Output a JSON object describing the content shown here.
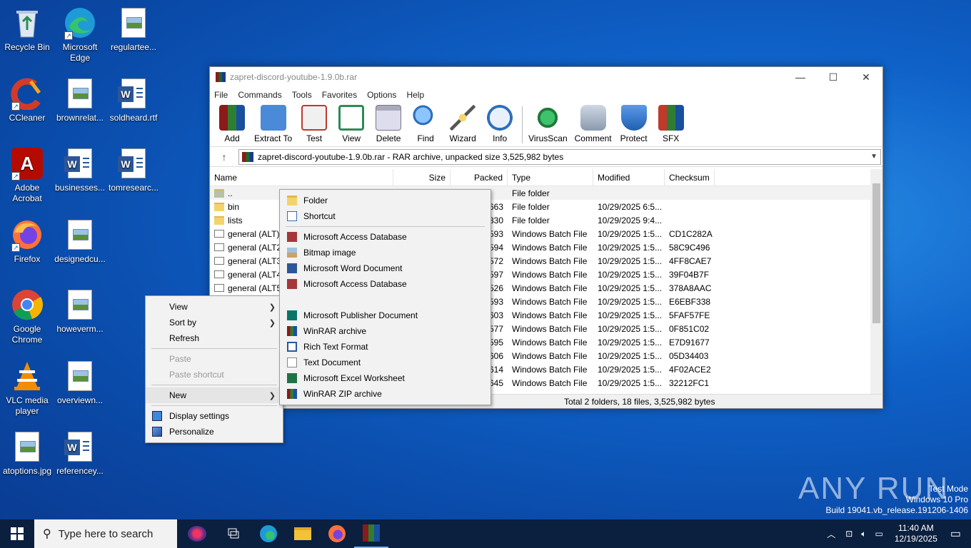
{
  "desktop": {
    "icons": [
      {
        "label": "Recycle Bin"
      },
      {
        "label": "Microsoft Edge"
      },
      {
        "label": "regulartee..."
      },
      {
        "label": "CCleaner"
      },
      {
        "label": "brownrelat..."
      },
      {
        "label": "soldheard.rtf"
      },
      {
        "label": "Adobe Acrobat"
      },
      {
        "label": "businesses..."
      },
      {
        "label": "tomresearc..."
      },
      {
        "label": "Firefox"
      },
      {
        "label": "designedcu..."
      },
      {
        "label": "Google Chrome"
      },
      {
        "label": "howeverm..."
      },
      {
        "label": "VLC media player"
      },
      {
        "label": "overviewn..."
      },
      {
        "label": "atoptions.jpg"
      },
      {
        "label": "referencey..."
      }
    ]
  },
  "window": {
    "title": "zapret-discord-youtube-1.9.0b.rar",
    "controls": {
      "minimize": "—",
      "maximize": "☐",
      "close": "✕"
    },
    "menu": [
      "File",
      "Commands",
      "Tools",
      "Favorites",
      "Options",
      "Help"
    ],
    "toolbar": [
      {
        "label": "Add",
        "icon": "add-icon",
        "color": "#c0392b"
      },
      {
        "label": "Extract To",
        "icon": "extract-icon",
        "color": "#3a7bd5"
      },
      {
        "label": "Test",
        "icon": "test-icon",
        "color": "#d9534f"
      },
      {
        "label": "View",
        "icon": "view-icon",
        "color": "#2e8b57"
      },
      {
        "label": "Delete",
        "icon": "delete-icon",
        "color": "#7f8c8d"
      },
      {
        "label": "Find",
        "icon": "find-icon",
        "color": "#2c6fbb"
      },
      {
        "label": "Wizard",
        "icon": "wizard-icon",
        "color": "#9b59b6"
      },
      {
        "label": "Info",
        "icon": "info-icon",
        "color": "#2c6fbb"
      },
      {
        "label": "VirusScan",
        "icon": "virusscan-icon",
        "color": "#27ae60"
      },
      {
        "label": "Comment",
        "icon": "comment-icon",
        "color": "#5d6d7e"
      },
      {
        "label": "Protect",
        "icon": "protect-icon",
        "color": "#2c6fbb"
      },
      {
        "label": "SFX",
        "icon": "sfx-icon",
        "color": "#c0392b"
      }
    ],
    "address": "zapret-discord-youtube-1.9.0b.rar - RAR archive, unpacked size 3,525,982 bytes",
    "columns": {
      "name": "Name",
      "size": "Size",
      "packed": "Packed",
      "type": "Type",
      "modified": "Modified",
      "checksum": "Checksum"
    },
    "rows": [
      {
        "name": "..",
        "packed": "",
        "type": "File folder",
        "modified": "",
        "checksum": "",
        "kind": "up"
      },
      {
        "name": "bin",
        "packed": "663",
        "type": "File folder",
        "modified": "10/29/2025 6:5...",
        "checksum": "",
        "kind": "folder"
      },
      {
        "name": "lists",
        "packed": "830",
        "type": "File folder",
        "modified": "10/29/2025 9:4...",
        "checksum": "",
        "kind": "folder"
      },
      {
        "name": "general (ALT).b",
        "packed": "593",
        "type": "Windows Batch File",
        "modified": "10/29/2025 1:5...",
        "checksum": "CD1C282A",
        "kind": "bat"
      },
      {
        "name": "general (ALT2).",
        "packed": "594",
        "type": "Windows Batch File",
        "modified": "10/29/2025 1:5...",
        "checksum": "58C9C496",
        "kind": "bat"
      },
      {
        "name": "general (ALT3).",
        "packed": "572",
        "type": "Windows Batch File",
        "modified": "10/29/2025 1:5...",
        "checksum": "4FF8CAE7",
        "kind": "bat"
      },
      {
        "name": "general (ALT4).",
        "packed": "597",
        "type": "Windows Batch File",
        "modified": "10/29/2025 1:5...",
        "checksum": "39F04B7F",
        "kind": "bat"
      },
      {
        "name": "general (ALT5).",
        "packed": "526",
        "type": "Windows Batch File",
        "modified": "10/29/2025 1:5...",
        "checksum": "378A8AAC",
        "kind": "bat"
      },
      {
        "name": "",
        "packed": "593",
        "type": "Windows Batch File",
        "modified": "10/29/2025 1:5...",
        "checksum": "E6EBF338",
        "kind": "bat"
      },
      {
        "name": "",
        "packed": "603",
        "type": "Windows Batch File",
        "modified": "10/29/2025 1:5...",
        "checksum": "5FAF57FE",
        "kind": "bat"
      },
      {
        "name": "",
        "packed": "577",
        "type": "Windows Batch File",
        "modified": "10/29/2025 1:5...",
        "checksum": "0F851C02",
        "kind": "bat"
      },
      {
        "name": "",
        "packed": "595",
        "type": "Windows Batch File",
        "modified": "10/29/2025 1:5...",
        "checksum": "E7D91677",
        "kind": "bat"
      },
      {
        "name": "",
        "packed": "606",
        "type": "Windows Batch File",
        "modified": "10/29/2025 1:5...",
        "checksum": "05D34403",
        "kind": "bat"
      },
      {
        "name": "",
        "packed": "614",
        "type": "Windows Batch File",
        "modified": "10/29/2025 1:5...",
        "checksum": "4F02ACE2",
        "kind": "bat"
      },
      {
        "name": "",
        "packed": "645",
        "type": "Windows Batch File",
        "modified": "10/29/2025 1:5...",
        "checksum": "32212FC1",
        "kind": "bat"
      }
    ],
    "status": "Total 2 folders, 18 files, 3,525,982 bytes"
  },
  "context_menu": {
    "view": "View",
    "sort_by": "Sort by",
    "refresh": "Refresh",
    "paste": "Paste",
    "paste_shortcut": "Paste shortcut",
    "new": "New",
    "display_settings": "Display settings",
    "personalize": "Personalize"
  },
  "new_menu": [
    {
      "label": "Folder",
      "icon": "folder-icon"
    },
    {
      "label": "Shortcut",
      "icon": "shortcut-icon"
    },
    {
      "label": "Microsoft Access Database",
      "icon": "access-icon"
    },
    {
      "label": "Bitmap image",
      "icon": "bitmap-icon"
    },
    {
      "label": "Microsoft Word Document",
      "icon": "word-icon"
    },
    {
      "label": "Microsoft Access Database",
      "icon": "access-icon"
    },
    {
      "label": "",
      "icon": ""
    },
    {
      "label": "Microsoft Publisher Document",
      "icon": "publisher-icon"
    },
    {
      "label": "WinRAR archive",
      "icon": "winrar-icon"
    },
    {
      "label": "Rich Text Format",
      "icon": "rtf-icon"
    },
    {
      "label": "Text Document",
      "icon": "text-icon"
    },
    {
      "label": "Microsoft Excel Worksheet",
      "icon": "excel-icon"
    },
    {
      "label": "WinRAR ZIP archive",
      "icon": "winrar-zip-icon"
    }
  ],
  "taskbar": {
    "search_placeholder": "Type here to search",
    "time": "11:40 AM",
    "date": "12/19/2025"
  },
  "watermark": {
    "line1": "Test Mode",
    "line2": "Windows 10 Pro",
    "line3": "Build 19041.vb_release.191206-1406",
    "brand": "ANY RUN"
  },
  "colors": {
    "desktop": "#0f62c9",
    "taskbar": "#0b1f3f",
    "accent": "#0078d7"
  }
}
